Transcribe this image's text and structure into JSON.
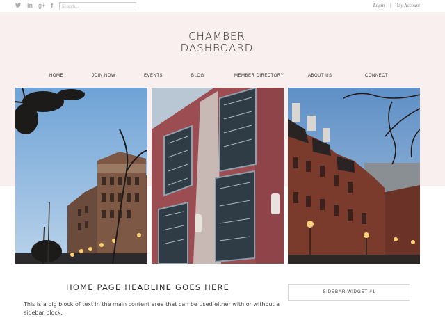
{
  "topbar": {
    "social": [
      {
        "icon": "twitter-icon",
        "glyph": "🐦"
      },
      {
        "icon": "linkedin-icon",
        "glyph": "in"
      },
      {
        "icon": "google-plus-icon",
        "glyph": "g+"
      },
      {
        "icon": "facebook-icon",
        "glyph": "f"
      }
    ],
    "search_placeholder": "Search...",
    "login": "Login",
    "separator": "|",
    "my_account": "My Account"
  },
  "logo": {
    "line1": "CHAMBER",
    "line2": "DASHBOARD"
  },
  "nav": {
    "home": "HOME",
    "join": "JOIN NOW",
    "events": "EVENTS",
    "blog": "BLOG",
    "directory": "MEMBER DIRECTORY",
    "about": "ABOUT US",
    "connect": "CONNECT"
  },
  "content": {
    "headline": "HOME PAGE HEADLINE GOES HERE",
    "body": "This is a big block of text in the main content area that can be used either with or without a sidebar block."
  },
  "sidebar": {
    "widget_title": "SIDEBAR WIDGET #1"
  },
  "colors": {
    "band": "#f9efee",
    "text": "#333333"
  }
}
